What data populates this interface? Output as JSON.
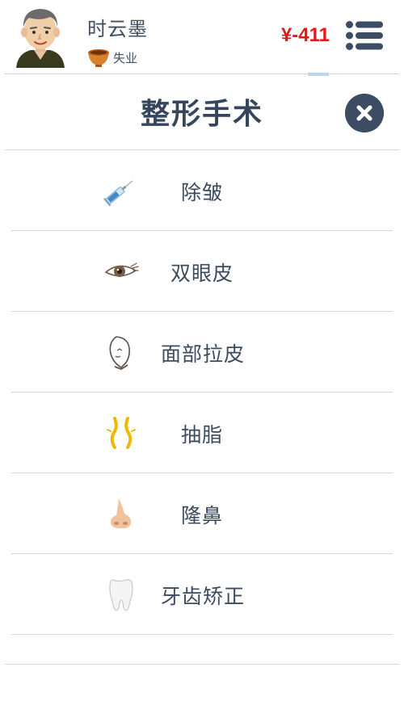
{
  "header": {
    "user_name": "时云墨",
    "status_text": "失业",
    "money": "¥-411"
  },
  "page": {
    "title": "整形手术"
  },
  "items": [
    {
      "label": "除皱",
      "icon": "syringe-icon"
    },
    {
      "label": "双眼皮",
      "icon": "eye-icon"
    },
    {
      "label": "面部拉皮",
      "icon": "face-outline-icon"
    },
    {
      "label": "抽脂",
      "icon": "liposuction-icon"
    },
    {
      "label": "隆鼻",
      "icon": "nose-icon"
    },
    {
      "label": "牙齿矫正",
      "icon": "tooth-icon"
    }
  ],
  "colors": {
    "money": "#e6161b",
    "dark": "#3c4c62"
  }
}
